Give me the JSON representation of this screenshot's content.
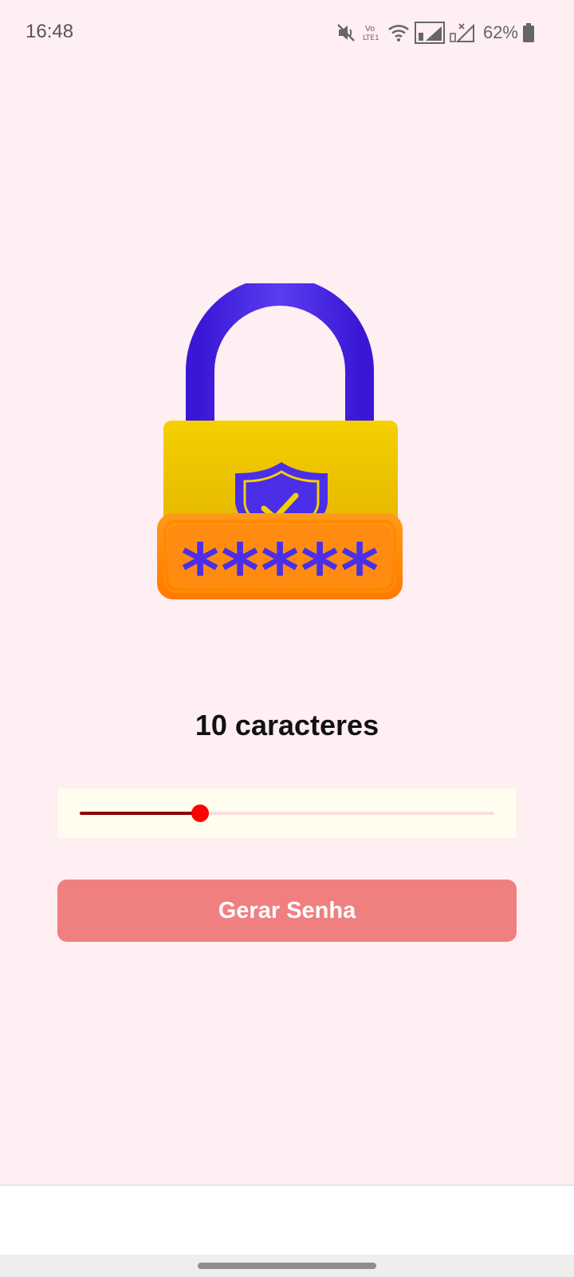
{
  "status_bar": {
    "time": "16:48",
    "battery_percent": "62%",
    "icons": [
      "mute-icon",
      "volte-icon",
      "wifi-icon",
      "signal-sim1-icon",
      "signal-sim2-icon",
      "battery-icon"
    ]
  },
  "illustration": {
    "icon": "padlock-password-icon",
    "colors": {
      "shackle": "#3d1de0",
      "body": "#f2cd00",
      "plate": "#ff8a00",
      "asterisk": "#4a2ee8"
    }
  },
  "password_length": {
    "label": "10 caracteres",
    "slider_fraction": 0.29
  },
  "generate_button": {
    "label": "Gerar Senha",
    "color": "#f08080"
  },
  "colors": {
    "background": "#ffeef2",
    "slider_active": "#8b0000",
    "slider_thumb": "#ff0000"
  }
}
